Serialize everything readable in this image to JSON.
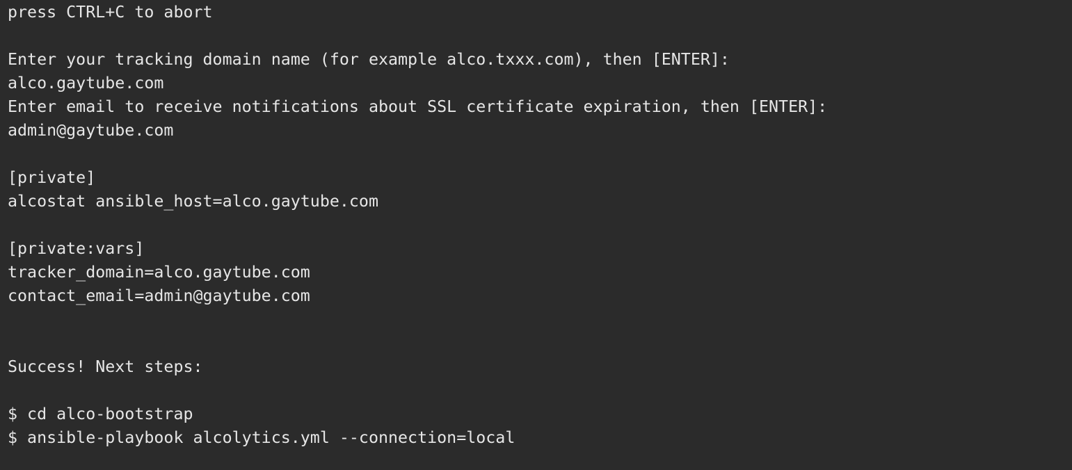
{
  "terminal": {
    "background": "#2b2b2b",
    "foreground": "#e6e6e6",
    "lines": [
      "press CTRL+C to abort",
      "",
      "Enter your tracking domain name (for example alco.txxx.com), then [ENTER]:",
      "alco.gaytube.com",
      "Enter email to receive notifications about SSL certificate expiration, then [ENTER]:",
      "admin@gaytube.com",
      "",
      "[private]",
      "alcostat ansible_host=alco.gaytube.com",
      "",
      "[private:vars]",
      "tracker_domain=alco.gaytube.com",
      "contact_email=admin@gaytube.com",
      "",
      "",
      "Success! Next steps:",
      "",
      "$ cd alco-bootstrap",
      "$ ansible-playbook alcolytics.yml --connection=local"
    ]
  }
}
